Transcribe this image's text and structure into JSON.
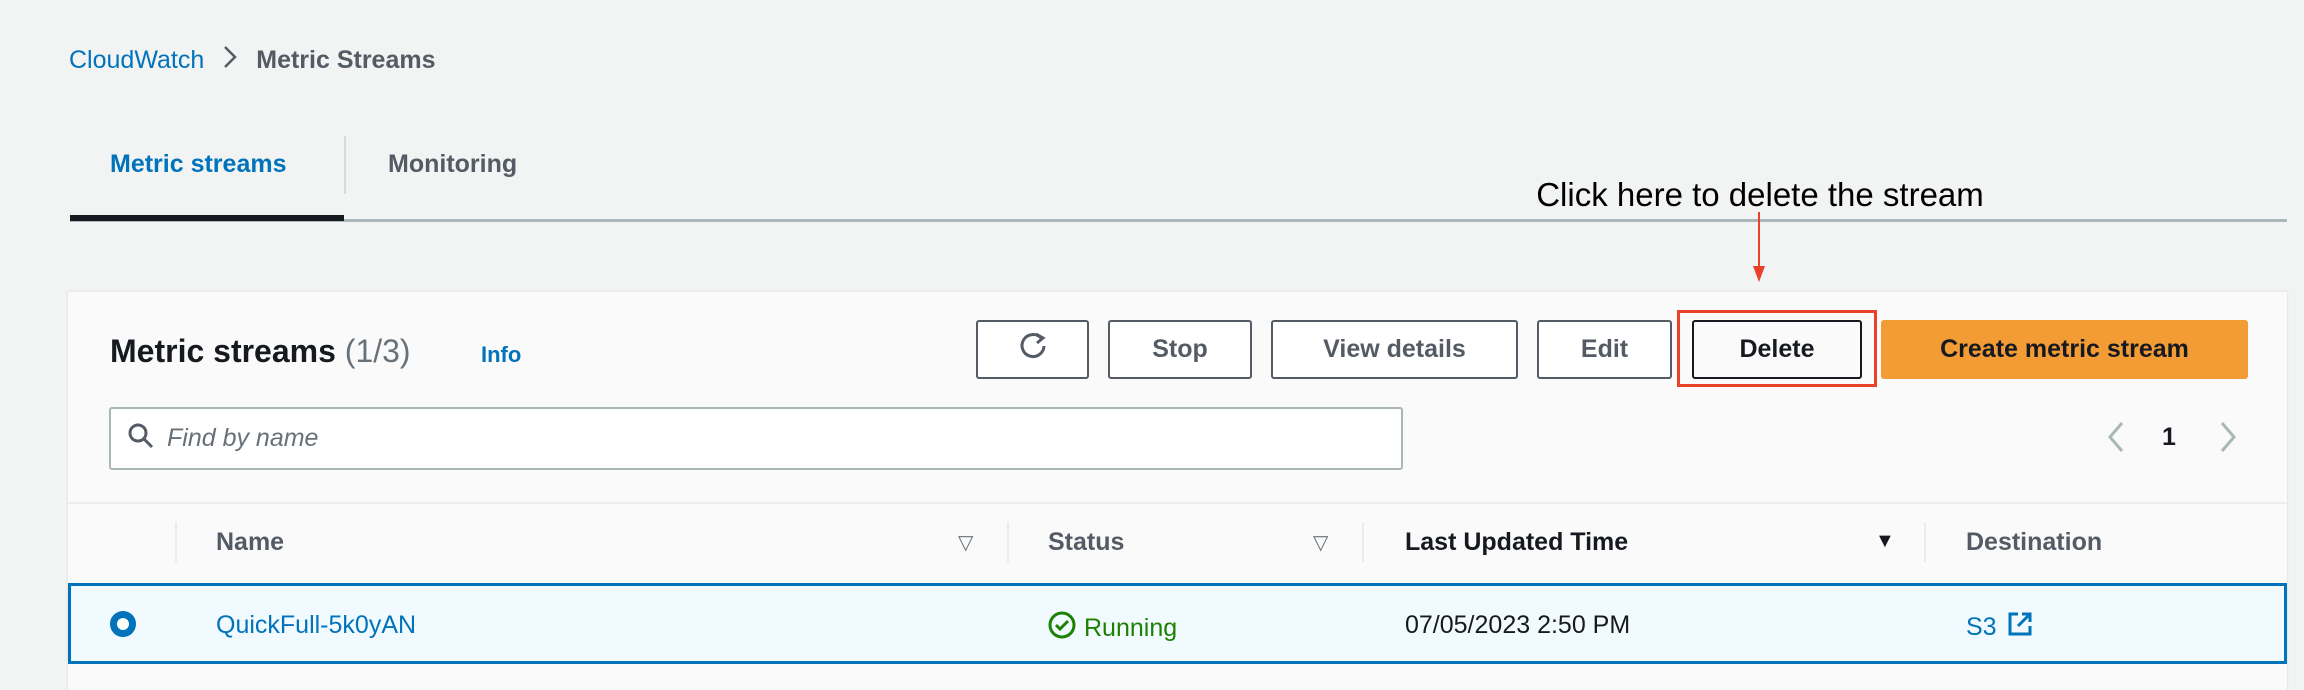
{
  "breadcrumb": {
    "root": "CloudWatch",
    "current": "Metric Streams"
  },
  "tabs": [
    {
      "label": "Metric streams",
      "active": true
    },
    {
      "label": "Monitoring",
      "active": false
    }
  ],
  "annotation": "Click here to delete the stream",
  "panel": {
    "title": "Metric streams",
    "count": "(1/3)",
    "info": "Info",
    "buttons": {
      "stop": "Stop",
      "view_details": "View details",
      "edit": "Edit",
      "delete": "Delete",
      "create": "Create metric stream"
    },
    "search_placeholder": "Find by name",
    "page": "1"
  },
  "table": {
    "columns": [
      "Name",
      "Status",
      "Last Updated Time",
      "Destination"
    ],
    "rows": [
      {
        "name": "QuickFull-5k0yAN",
        "status": "Running",
        "updated": "07/05/2023 2:50 PM",
        "destination": "S3",
        "selected": true
      }
    ]
  },
  "colors": {
    "accent": "#0073bb",
    "primary_button": "#f39c36",
    "success": "#1d8102",
    "highlight": "#e8422a"
  }
}
